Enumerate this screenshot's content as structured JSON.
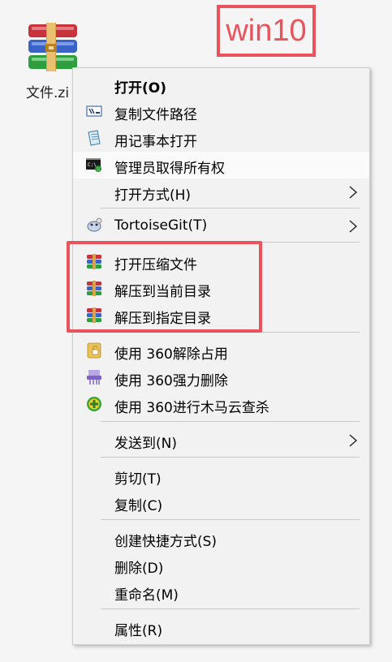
{
  "desktop": {
    "file_label": "文件.zi",
    "annotation": "win10"
  },
  "colors": {
    "annotation_red": "#e9535c",
    "menu_bg": "#f2f2f2"
  },
  "menu": {
    "items": [
      {
        "label": "打开(O)",
        "icon": "none"
      },
      {
        "label": "复制文件路径",
        "icon": "path-icon"
      },
      {
        "label": "用记事本打开",
        "icon": "notepad-icon"
      },
      {
        "label": "管理员取得所有权",
        "icon": "cmd-admin-icon"
      },
      {
        "label": "打开方式(H)",
        "icon": "none"
      },
      {
        "label": "TortoiseGit(T)",
        "icon": "tortoisegit-icon"
      },
      {
        "label": "打开压缩文件",
        "icon": "winrar-icon"
      },
      {
        "label": "解压到当前目录",
        "icon": "winrar-icon"
      },
      {
        "label": "解压到指定目录",
        "icon": "winrar-icon"
      },
      {
        "label": "使用 360解除占用",
        "icon": "360-unlock-icon"
      },
      {
        "label": "使用 360强力删除",
        "icon": "360-shredder-icon"
      },
      {
        "label": "使用 360进行木马云查杀",
        "icon": "360-scan-icon"
      },
      {
        "label": "发送到(N)",
        "icon": "none"
      },
      {
        "label": "剪切(T)",
        "icon": "none"
      },
      {
        "label": "复制(C)",
        "icon": "none"
      },
      {
        "label": "创建快捷方式(S)",
        "icon": "none"
      },
      {
        "label": "删除(D)",
        "icon": "none"
      },
      {
        "label": "重命名(M)",
        "icon": "none"
      },
      {
        "label": "属性(R)",
        "icon": "none"
      }
    ]
  }
}
